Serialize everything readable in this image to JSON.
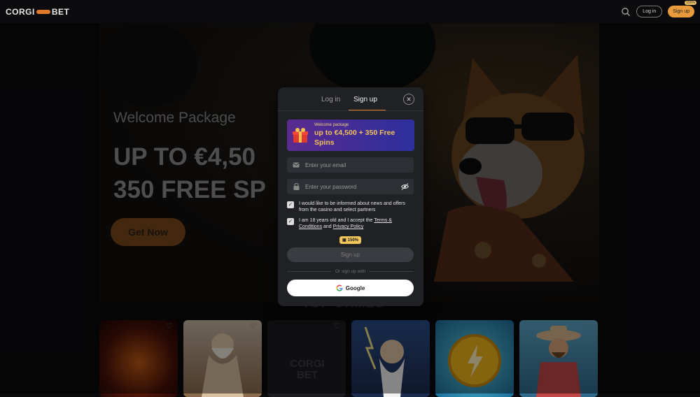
{
  "header": {
    "logo_left": "CORGI",
    "logo_right": "BET",
    "login_label": "Log in",
    "signup_label": "Sign up",
    "signup_tag": "150%"
  },
  "hero": {
    "kicker": "Welcome Package",
    "title": "UP TO €4,50\n350 FREE SP",
    "cta": "Get Now"
  },
  "games_section": {
    "title": "TOP GAMES",
    "cards": [
      {
        "name": "game-1"
      },
      {
        "name": "game-2"
      },
      {
        "name": "game-3"
      },
      {
        "name": "game-4"
      },
      {
        "name": "game-5"
      },
      {
        "name": "game-6"
      }
    ],
    "placeholder_logo": "CORGI BET"
  },
  "modal": {
    "tab_login": "Log in",
    "tab_signup": "Sign up",
    "promo_small": "Welcome package",
    "promo_big": "up to €4,500 + 350 Free Spins",
    "email_placeholder": "Enter your email",
    "password_placeholder": "Enter your password",
    "consent_news": "I would like to be informed about news and offers from the casino and select partners",
    "consent_age_prefix": "I am 18 years old and I accept the ",
    "terms_link": "Terms & Conditions",
    "consent_and": " and ",
    "privacy_link": "Privacy Policy",
    "badge": "150%",
    "submit_label": "Sign up",
    "divider": "Or sign up with",
    "google_label": "Google"
  },
  "colors": {
    "accent": "#e07a2a",
    "promo_start": "#5a2b8f",
    "promo_end": "#2c2f9c",
    "modal_bg": "#1f2125"
  }
}
